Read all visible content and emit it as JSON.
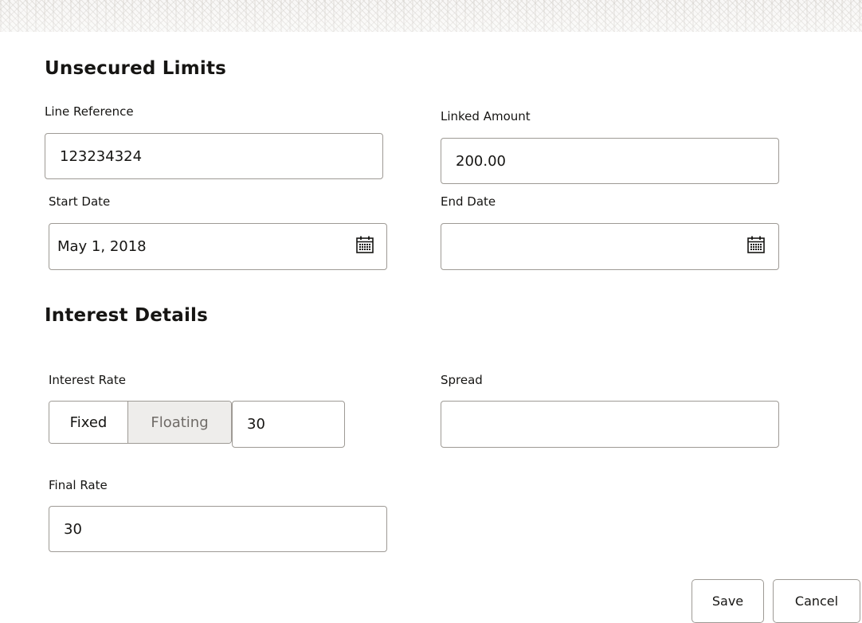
{
  "sections": {
    "unsecured_limits_title": "Unsecured Limits",
    "interest_details_title": "Interest Details"
  },
  "fields": {
    "line_reference": {
      "label": "Line Reference",
      "value": "123234324"
    },
    "linked_amount": {
      "label": "Linked Amount",
      "value": "200.00"
    },
    "start_date": {
      "label": "Start Date",
      "value": "May 1, 2018",
      "icon": "calendar-icon"
    },
    "end_date": {
      "label": "End Date",
      "value": "",
      "icon": "calendar-icon"
    },
    "interest_rate": {
      "label": "Interest Rate",
      "options": [
        "Fixed",
        "Floating"
      ],
      "selected": "Fixed",
      "value": "30"
    },
    "spread": {
      "label": "Spread",
      "value": ""
    },
    "final_rate": {
      "label": "Final Rate",
      "value": "30"
    }
  },
  "actions": {
    "save_label": "Save",
    "cancel_label": "Cancel"
  },
  "colors": {
    "text": "#161513",
    "border": "#9e9a95",
    "segment_unselected_bg": "#eeedeb",
    "segment_unselected_text": "#6f6b67"
  }
}
